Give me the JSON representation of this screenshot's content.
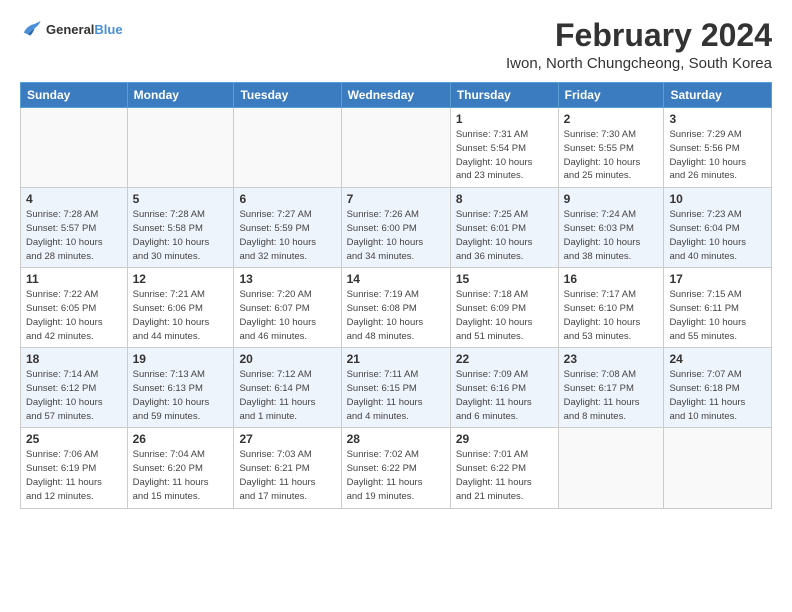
{
  "logo": {
    "line1": "General",
    "line2": "Blue"
  },
  "title": "February 2024",
  "subtitle": "Iwon, North Chungcheong, South Korea",
  "weekdays": [
    "Sunday",
    "Monday",
    "Tuesday",
    "Wednesday",
    "Thursday",
    "Friday",
    "Saturday"
  ],
  "weeks": [
    [
      {
        "day": "",
        "info": ""
      },
      {
        "day": "",
        "info": ""
      },
      {
        "day": "",
        "info": ""
      },
      {
        "day": "",
        "info": ""
      },
      {
        "day": "1",
        "info": "Sunrise: 7:31 AM\nSunset: 5:54 PM\nDaylight: 10 hours\nand 23 minutes."
      },
      {
        "day": "2",
        "info": "Sunrise: 7:30 AM\nSunset: 5:55 PM\nDaylight: 10 hours\nand 25 minutes."
      },
      {
        "day": "3",
        "info": "Sunrise: 7:29 AM\nSunset: 5:56 PM\nDaylight: 10 hours\nand 26 minutes."
      }
    ],
    [
      {
        "day": "4",
        "info": "Sunrise: 7:28 AM\nSunset: 5:57 PM\nDaylight: 10 hours\nand 28 minutes."
      },
      {
        "day": "5",
        "info": "Sunrise: 7:28 AM\nSunset: 5:58 PM\nDaylight: 10 hours\nand 30 minutes."
      },
      {
        "day": "6",
        "info": "Sunrise: 7:27 AM\nSunset: 5:59 PM\nDaylight: 10 hours\nand 32 minutes."
      },
      {
        "day": "7",
        "info": "Sunrise: 7:26 AM\nSunset: 6:00 PM\nDaylight: 10 hours\nand 34 minutes."
      },
      {
        "day": "8",
        "info": "Sunrise: 7:25 AM\nSunset: 6:01 PM\nDaylight: 10 hours\nand 36 minutes."
      },
      {
        "day": "9",
        "info": "Sunrise: 7:24 AM\nSunset: 6:03 PM\nDaylight: 10 hours\nand 38 minutes."
      },
      {
        "day": "10",
        "info": "Sunrise: 7:23 AM\nSunset: 6:04 PM\nDaylight: 10 hours\nand 40 minutes."
      }
    ],
    [
      {
        "day": "11",
        "info": "Sunrise: 7:22 AM\nSunset: 6:05 PM\nDaylight: 10 hours\nand 42 minutes."
      },
      {
        "day": "12",
        "info": "Sunrise: 7:21 AM\nSunset: 6:06 PM\nDaylight: 10 hours\nand 44 minutes."
      },
      {
        "day": "13",
        "info": "Sunrise: 7:20 AM\nSunset: 6:07 PM\nDaylight: 10 hours\nand 46 minutes."
      },
      {
        "day": "14",
        "info": "Sunrise: 7:19 AM\nSunset: 6:08 PM\nDaylight: 10 hours\nand 48 minutes."
      },
      {
        "day": "15",
        "info": "Sunrise: 7:18 AM\nSunset: 6:09 PM\nDaylight: 10 hours\nand 51 minutes."
      },
      {
        "day": "16",
        "info": "Sunrise: 7:17 AM\nSunset: 6:10 PM\nDaylight: 10 hours\nand 53 minutes."
      },
      {
        "day": "17",
        "info": "Sunrise: 7:15 AM\nSunset: 6:11 PM\nDaylight: 10 hours\nand 55 minutes."
      }
    ],
    [
      {
        "day": "18",
        "info": "Sunrise: 7:14 AM\nSunset: 6:12 PM\nDaylight: 10 hours\nand 57 minutes."
      },
      {
        "day": "19",
        "info": "Sunrise: 7:13 AM\nSunset: 6:13 PM\nDaylight: 10 hours\nand 59 minutes."
      },
      {
        "day": "20",
        "info": "Sunrise: 7:12 AM\nSunset: 6:14 PM\nDaylight: 11 hours\nand 1 minute."
      },
      {
        "day": "21",
        "info": "Sunrise: 7:11 AM\nSunset: 6:15 PM\nDaylight: 11 hours\nand 4 minutes."
      },
      {
        "day": "22",
        "info": "Sunrise: 7:09 AM\nSunset: 6:16 PM\nDaylight: 11 hours\nand 6 minutes."
      },
      {
        "day": "23",
        "info": "Sunrise: 7:08 AM\nSunset: 6:17 PM\nDaylight: 11 hours\nand 8 minutes."
      },
      {
        "day": "24",
        "info": "Sunrise: 7:07 AM\nSunset: 6:18 PM\nDaylight: 11 hours\nand 10 minutes."
      }
    ],
    [
      {
        "day": "25",
        "info": "Sunrise: 7:06 AM\nSunset: 6:19 PM\nDaylight: 11 hours\nand 12 minutes."
      },
      {
        "day": "26",
        "info": "Sunrise: 7:04 AM\nSunset: 6:20 PM\nDaylight: 11 hours\nand 15 minutes."
      },
      {
        "day": "27",
        "info": "Sunrise: 7:03 AM\nSunset: 6:21 PM\nDaylight: 11 hours\nand 17 minutes."
      },
      {
        "day": "28",
        "info": "Sunrise: 7:02 AM\nSunset: 6:22 PM\nDaylight: 11 hours\nand 19 minutes."
      },
      {
        "day": "29",
        "info": "Sunrise: 7:01 AM\nSunset: 6:22 PM\nDaylight: 11 hours\nand 21 minutes."
      },
      {
        "day": "",
        "info": ""
      },
      {
        "day": "",
        "info": ""
      }
    ]
  ]
}
